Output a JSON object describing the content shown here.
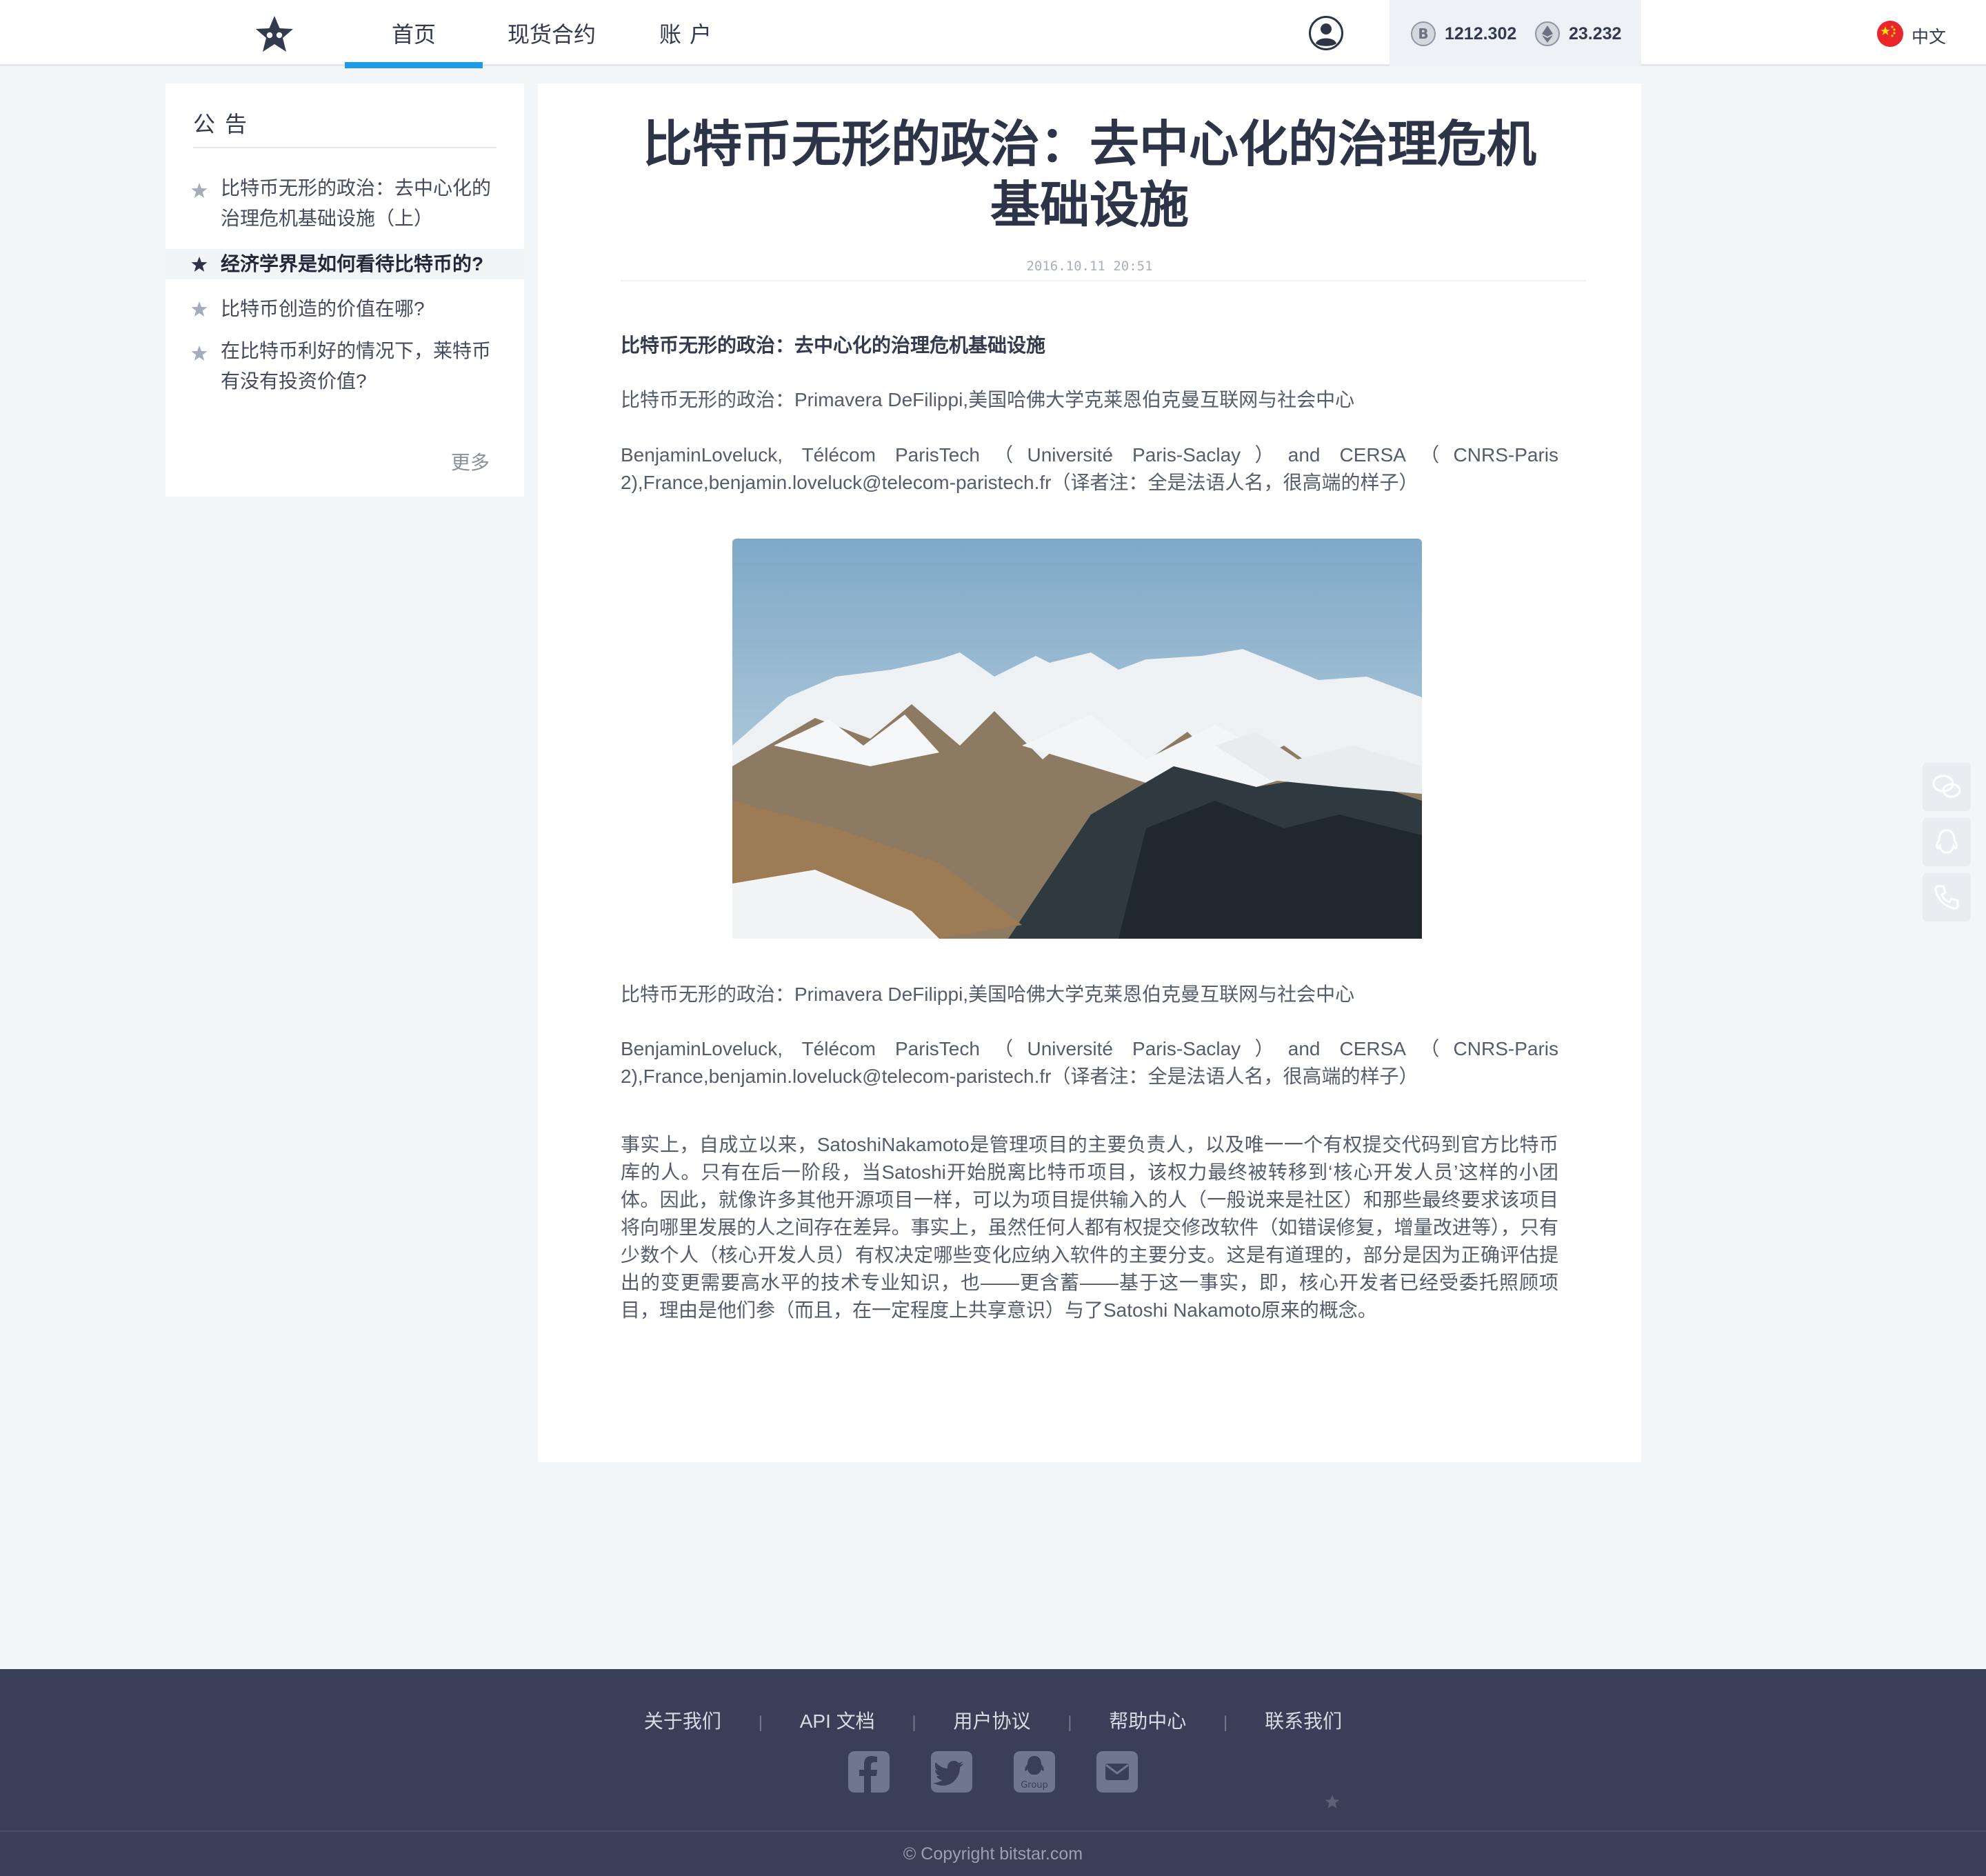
{
  "header": {
    "tabs": [
      {
        "label": "首页",
        "active": true
      },
      {
        "label": "现货合约",
        "active": false
      },
      {
        "label": "账户",
        "active": false
      }
    ],
    "balances": [
      {
        "icon": "bitcoin-icon",
        "value": "1212.302"
      },
      {
        "icon": "ethereum-icon",
        "value": "23.232"
      }
    ],
    "language": "中文"
  },
  "sidebar": {
    "title": "公告",
    "items": [
      {
        "label": "比特币无形的政治：去中心化的治理危机基础设施（上）",
        "highlight": false
      },
      {
        "label": "经济学界是如何看待比特币的?",
        "highlight": true
      },
      {
        "label": "比特币创造的价值在哪?",
        "highlight": false
      },
      {
        "label": "在比特币利好的情况下，莱特币有没有投资价值?",
        "highlight": false
      }
    ],
    "more": "更多"
  },
  "article": {
    "title": "比特币无形的政治：去中心化的治理危机基础设施",
    "date": "2016.10.11 20:51",
    "paragraphs": [
      "比特币无形的政治：去中心化的治理危机基础设施",
      "比特币无形的政治：Primavera DeFilippi,美国哈佛大学克莱恩伯克曼互联网与社会中心",
      "BenjaminLoveluck, Télécom ParisTech（Université Paris-Saclay）and CERSA（CNRS-Paris 2),France,benjamin.loveluck@telecom-paristech.fr（译者注：全是法语人名，很高端的样子）",
      "比特币无形的政治：Primavera DeFilippi,美国哈佛大学克莱恩伯克曼互联网与社会中心",
      "BenjaminLoveluck, Télécom ParisTech（Université Paris-Saclay）and CERSA（CNRS-Paris 2),France,benjamin.loveluck@telecom-paristech.fr（译者注：全是法语人名，很高端的样子）",
      "事实上，自成立以来，SatoshiNakamoto是管理项目的主要负责人，以及唯一一个有权提交代码到官方比特币库的人。只有在后一阶段，当Satoshi开始脱离比特币项目，该权力最终被转移到‘核心开发人员’这样的小团体。因此，就像许多其他开源项目一样，可以为项目提供输入的人（一般说来是社区）和那些最终要求该项目将向哪里发展的人之间存在差异。事实上，虽然任何人都有权提交修改软件（如错误修复，增量改进等），只有少数个人（核心开发人员）有权决定哪些变化应纳入软件的主要分支。这是有道理的，部分是因为正确评估提出的变更需要高水平的技术专业知识，也——更含蓄——基于这一事实，即，核心开发者已经受委托照顾项目，理由是他们参（而且，在一定程度上共享意识）与了Satoshi Nakamoto原来的概念。"
    ]
  },
  "floating": [
    "wechat-icon",
    "qq-icon",
    "phone-icon"
  ],
  "footer": {
    "links": [
      "关于我们",
      "API 文档",
      "用户协议",
      "帮助中心",
      "联系我们"
    ],
    "social": [
      "facebook-icon",
      "twitter-icon",
      "qq-group-icon",
      "email-icon"
    ],
    "qq_group_label": "Group",
    "copyright": "© Copyright   bitstar.com"
  },
  "colors": {
    "accent": "#1d9be6",
    "footer_bg": "#393f56",
    "page_bg": "#f2f6f9"
  }
}
